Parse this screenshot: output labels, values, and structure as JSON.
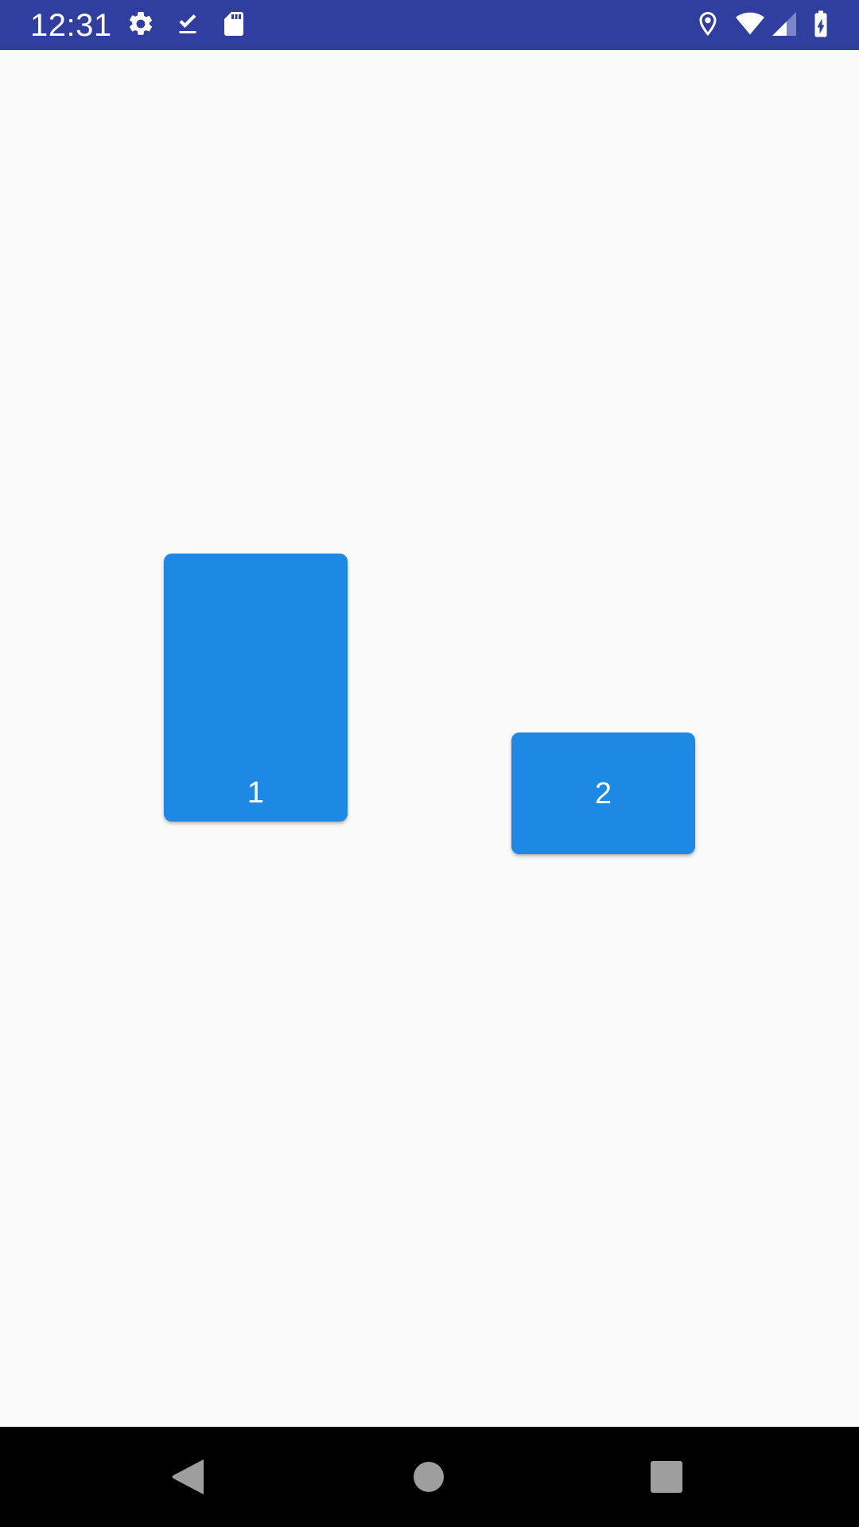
{
  "status_bar": {
    "time": "12:31",
    "background_color": "#303F9F",
    "left_icons": [
      "settings-gear-icon",
      "download-done-icon",
      "sd-card-icon"
    ],
    "right_icons": [
      "location-pin-icon",
      "wifi-icon",
      "cell-signal-icon",
      "battery-charging-icon"
    ]
  },
  "content": {
    "background_color": "#FAFAFA",
    "tiles": [
      {
        "label": "1",
        "color": "#1E88E5"
      },
      {
        "label": "2",
        "color": "#1E88E5"
      }
    ]
  },
  "nav_bar": {
    "background_color": "#000000",
    "buttons": [
      "back-icon",
      "home-icon",
      "recents-icon"
    ]
  }
}
